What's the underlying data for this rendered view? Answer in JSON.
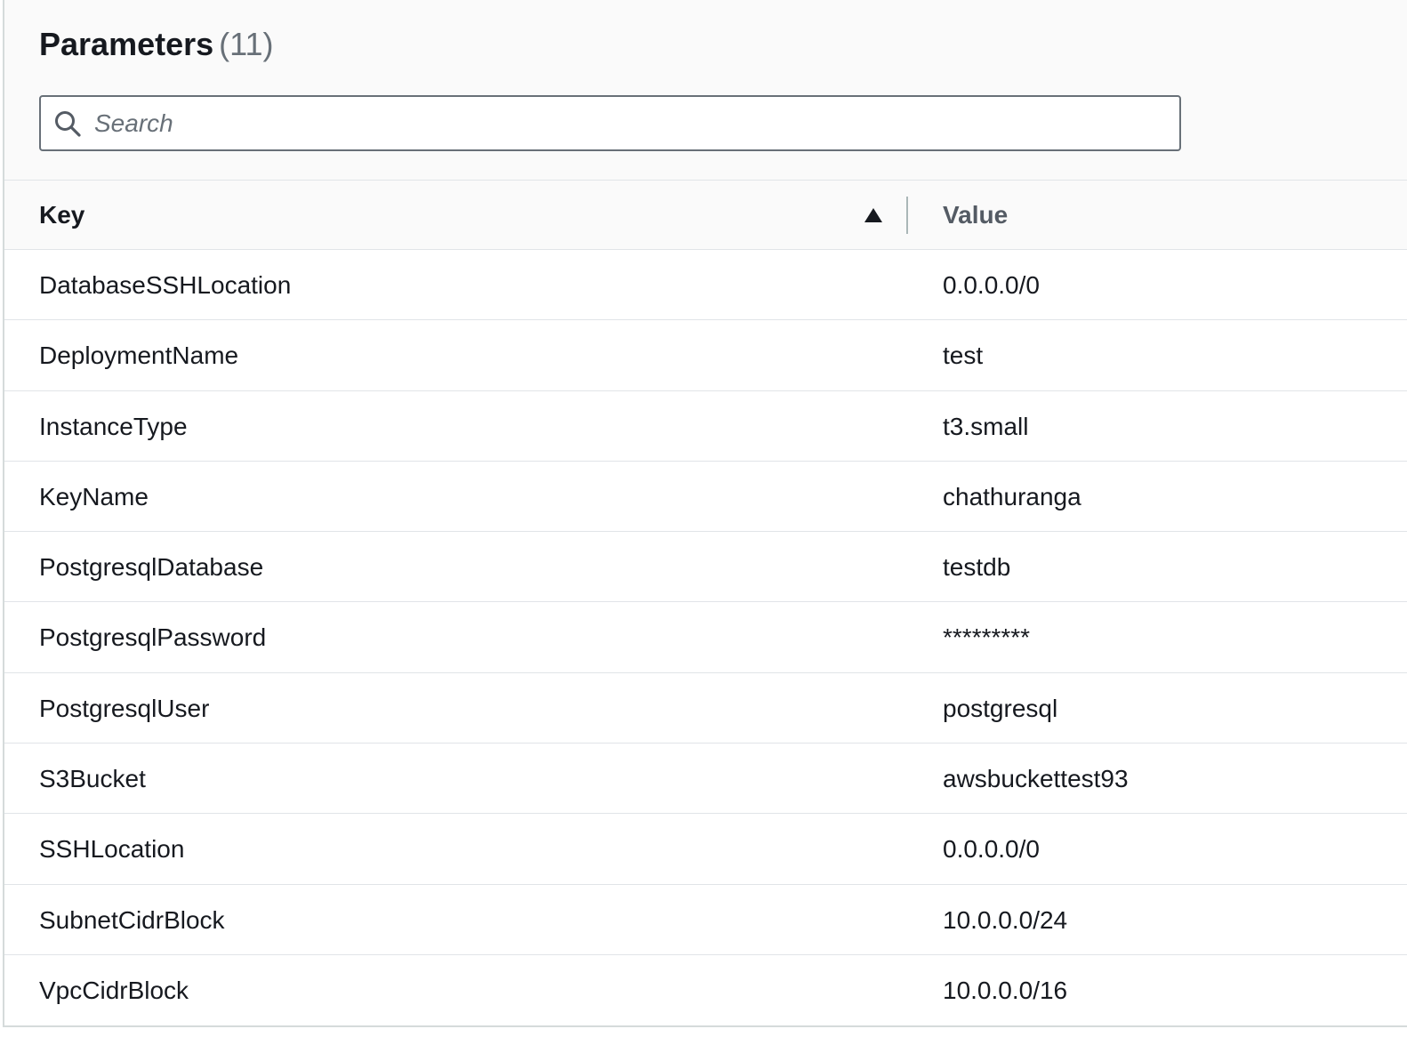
{
  "header": {
    "title": "Parameters",
    "count": "(11)"
  },
  "search": {
    "placeholder": "Search",
    "value": ""
  },
  "table": {
    "columns": {
      "key": "Key",
      "value": "Value"
    },
    "sort": {
      "column": "Key",
      "direction": "ascending"
    },
    "rows": [
      {
        "key": "DatabaseSSHLocation",
        "value": "0.0.0.0/0"
      },
      {
        "key": "DeploymentName",
        "value": "test"
      },
      {
        "key": "InstanceType",
        "value": "t3.small"
      },
      {
        "key": "KeyName",
        "value": "chathuranga"
      },
      {
        "key": "PostgresqlDatabase",
        "value": "testdb"
      },
      {
        "key": "PostgresqlPassword",
        "value": "*********"
      },
      {
        "key": "PostgresqlUser",
        "value": "postgresql"
      },
      {
        "key": "S3Bucket",
        "value": "awsbuckettest93"
      },
      {
        "key": "SSHLocation",
        "value": "0.0.0.0/0"
      },
      {
        "key": "SubnetCidrBlock",
        "value": "10.0.0.0/24"
      },
      {
        "key": "VpcCidrBlock",
        "value": "10.0.0.0/16"
      }
    ]
  },
  "icons": {
    "search": "search-icon",
    "sort": "caret-up-icon"
  }
}
